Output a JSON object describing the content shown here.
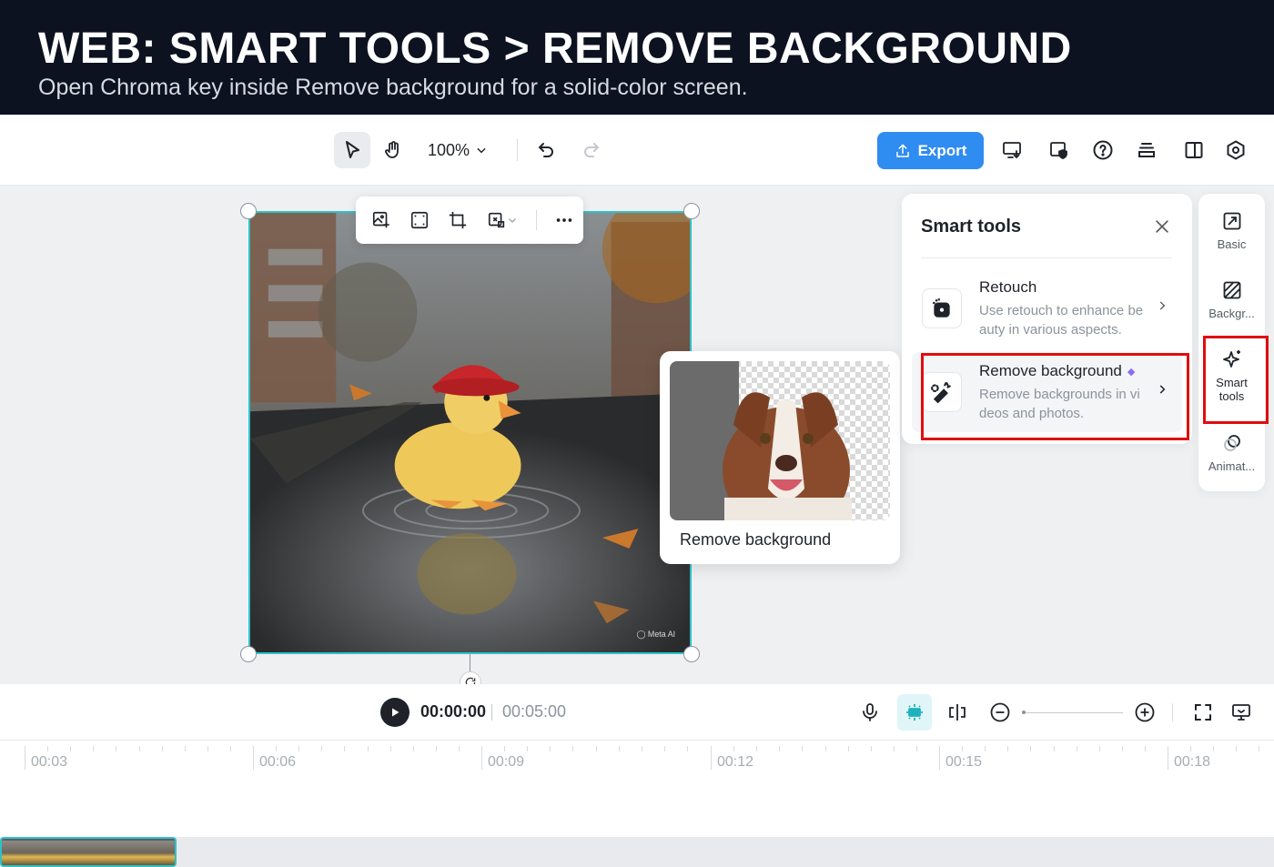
{
  "banner": {
    "title": "WEB: SMART TOOLS > REMOVE BACKGROUND",
    "subtitle": "Open Chroma key inside Remove background for a solid-color screen."
  },
  "toolbar": {
    "zoom": "100%",
    "export_label": "Export",
    "icons": [
      "select-pointer-icon",
      "hand-icon",
      "undo-icon",
      "redo-icon",
      "monitor-download-icon",
      "shield-check-icon",
      "help-icon",
      "layers-icon",
      "panel-split-icon",
      "settings-hex-icon"
    ]
  },
  "float_bar": {
    "icons": [
      "image-add-icon",
      "focus-frame-icon",
      "crop-icon",
      "replace-image-icon",
      "chevron-down-icon",
      "more-icon"
    ]
  },
  "preview": {
    "label": "Remove background"
  },
  "smart_tools": {
    "title": "Smart tools",
    "items": [
      {
        "title": "Retouch",
        "desc": "Use retouch to enhance be auty in various aspects."
      },
      {
        "title": "Remove background",
        "desc": "Remove backgrounds in vi deos and photos."
      }
    ]
  },
  "rail": {
    "items": [
      {
        "label": "Basic"
      },
      {
        "label": "Backgr..."
      },
      {
        "label": "Smart tools"
      },
      {
        "label": "Animat..."
      }
    ]
  },
  "playback": {
    "current_time": "00:00:00",
    "total_time": "00:05:00"
  },
  "timeline": {
    "ticks": [
      "00:03",
      "00:06",
      "00:09",
      "00:12",
      "00:15",
      "00:18"
    ]
  },
  "colors": {
    "accent": "#2f8cf0",
    "selection": "#2ec1c9",
    "highlight": "#e00d0d",
    "banner_bg": "#0c1220"
  }
}
